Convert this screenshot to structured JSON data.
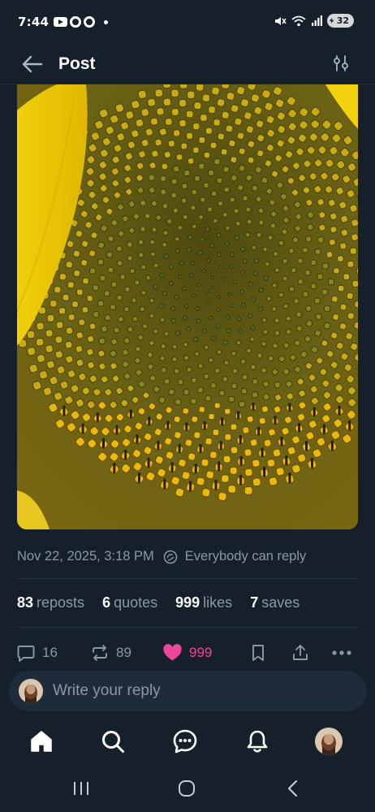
{
  "status_bar": {
    "time": "7:44",
    "battery": "32",
    "icons": [
      "youtube-icon",
      "app-circle-icon",
      "app-circle-icon",
      "dot-icon",
      "mute-icon",
      "wifi-icon",
      "signal-icon",
      "battery-icon"
    ]
  },
  "header": {
    "title": "Post",
    "back_icon": "arrow-left-icon",
    "filter_icon": "sliders-icon"
  },
  "post": {
    "image": {
      "subject": "sunflower-center"
    },
    "date": "Nov 22, 2025, 3:18 PM",
    "reply_setting": "Everybody can reply"
  },
  "stats": {
    "reposts": {
      "count": "83",
      "label": "reposts"
    },
    "quotes": {
      "count": "6",
      "label": "quotes"
    },
    "likes": {
      "count": "999",
      "label": "likes"
    },
    "saves": {
      "count": "7",
      "label": "saves"
    }
  },
  "actions": {
    "replies": "16",
    "reposts": "89",
    "likes": "999",
    "like_color": "#ec4899"
  },
  "reply_box": {
    "placeholder": "Write your reply"
  },
  "bottom_nav": {
    "items": [
      "home-icon",
      "search-icon",
      "chat-icon",
      "bell-icon",
      "profile-avatar"
    ]
  },
  "colors": {
    "background": "#15202b",
    "muted_text": "#8b98a5",
    "accent_pink": "#ec4899",
    "reply_bar": "#1e2b3b"
  }
}
